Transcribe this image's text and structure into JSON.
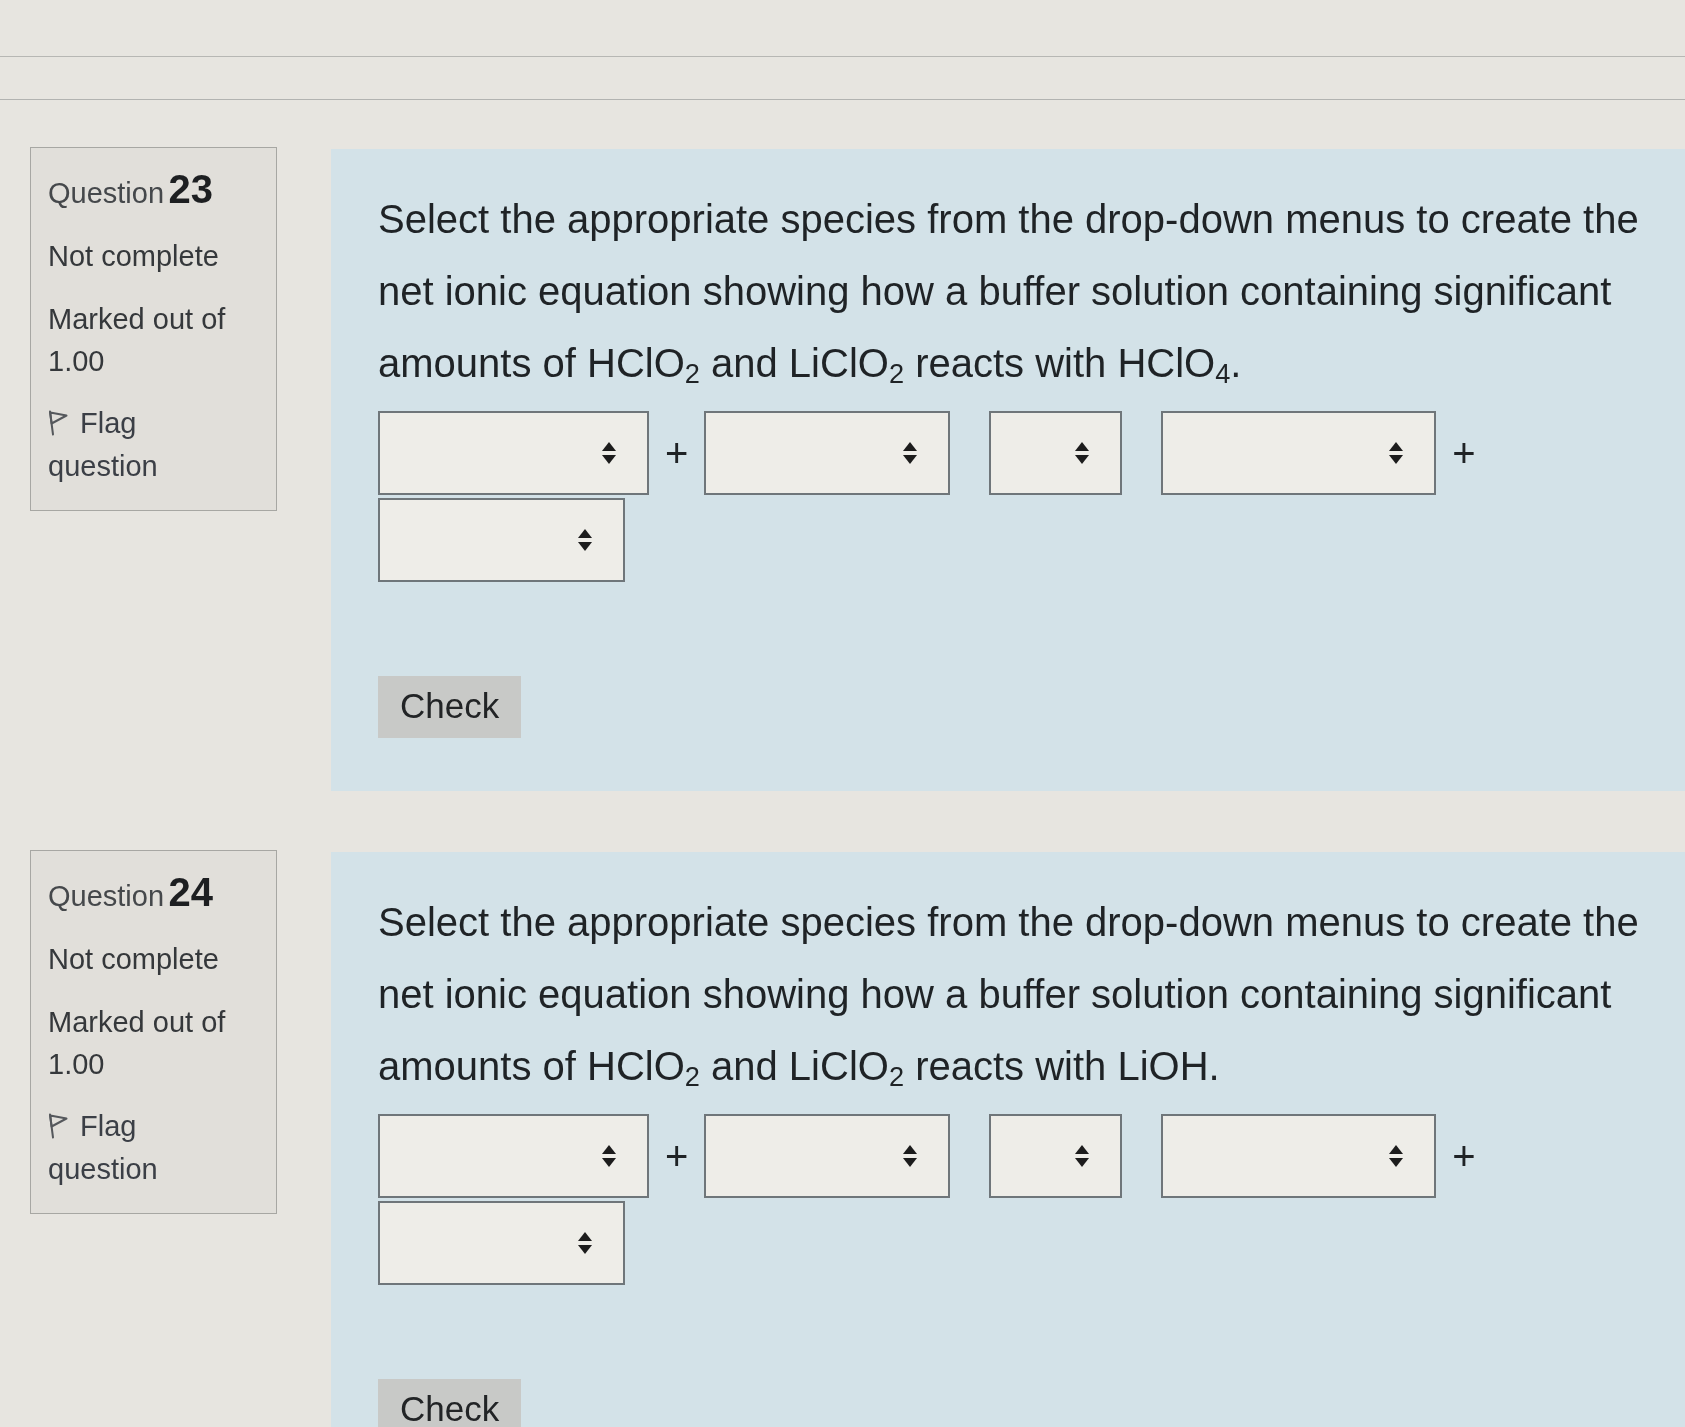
{
  "questions": [
    {
      "label": "Question",
      "number": "23",
      "status": "Not complete",
      "mark": "Marked out of 1.00",
      "flag_label": "Flag question",
      "flagged": false,
      "text": "Select the appropriate species from the drop-down menus to create the net ionic equation showing how a buffer solution containing significant amounts of HClO$_{2}$ and LiClO$_{2}$ reacts with HClO$_{4}$.",
      "equation": [
        {
          "kind": "dropdown"
        },
        {
          "kind": "operator",
          "symbol": "+"
        },
        {
          "kind": "dropdown"
        },
        {
          "kind": "dropdown"
        },
        {
          "kind": "dropdown"
        },
        {
          "kind": "operator",
          "symbol": "+"
        },
        {
          "kind": "dropdown"
        }
      ],
      "check_button": "Check"
    },
    {
      "label": "Question",
      "number": "24",
      "status": "Not complete",
      "mark": "Marked out of 1.00",
      "flag_label": "Flag question",
      "flagged": false,
      "text": "Select the appropriate species from the drop-down menus to create the net ionic equation showing how a buffer solution containing significant amounts of HClO$_{2}$ and LiClO$_{2}$ reacts with LiOH.",
      "equation": [
        {
          "kind": "dropdown"
        },
        {
          "kind": "operator",
          "symbol": "+"
        },
        {
          "kind": "dropdown"
        },
        {
          "kind": "dropdown"
        },
        {
          "kind": "dropdown"
        },
        {
          "kind": "operator",
          "symbol": "+"
        },
        {
          "kind": "dropdown"
        }
      ],
      "check_button": "Check"
    }
  ]
}
